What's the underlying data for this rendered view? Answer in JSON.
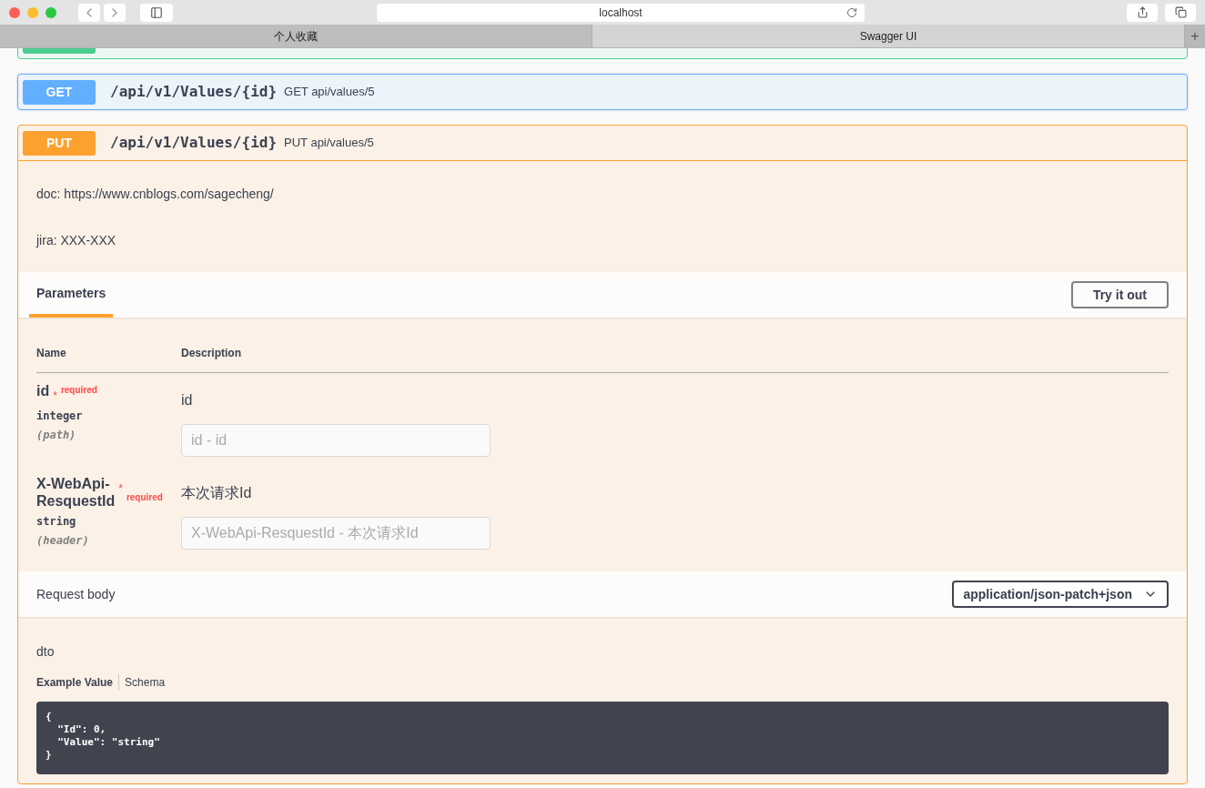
{
  "browser": {
    "address": "localhost",
    "tabs": [
      {
        "label": "个人收藏",
        "selected": false
      },
      {
        "label": "Swagger UI",
        "selected": true
      }
    ],
    "new_tab": "+"
  },
  "partial_operation": {
    "kind": "post"
  },
  "operations": [
    {
      "method": "GET",
      "kind": "get",
      "path": "/api/v1/Values/{id}",
      "summary": "GET api/values/5",
      "expanded": false
    },
    {
      "method": "PUT",
      "kind": "put",
      "path": "/api/v1/Values/{id}",
      "summary": "PUT api/values/5",
      "expanded": true
    }
  ],
  "details": {
    "description": [
      "doc: https://www.cnblogs.com/sagecheng/",
      "jira: XXX-XXX"
    ],
    "parameters_tab": "Parameters",
    "try_button": "Try it out",
    "columns": [
      "Name",
      "Description"
    ],
    "parameters": [
      {
        "name": "id",
        "required_mark": "*",
        "required": "required",
        "type": "integer",
        "location": "(path)",
        "description": "id",
        "placeholder": "id - id"
      },
      {
        "name": "X-WebApi-ResquestId",
        "required_mark": "*",
        "required": "required",
        "type": "string",
        "location": "(header)",
        "description": "本次请求Id",
        "placeholder": "X-WebApi-ResquestId - 本次请求Id"
      }
    ],
    "request_body": {
      "label": "Request body",
      "content_type": "application/json-patch+json",
      "name": "dto",
      "tabs": [
        {
          "label": "Example Value",
          "selected": true
        },
        {
          "label": "Schema",
          "selected": false
        }
      ],
      "example": "{\n  \"Id\": 0,\n  \"Value\": \"string\"\n}"
    }
  }
}
